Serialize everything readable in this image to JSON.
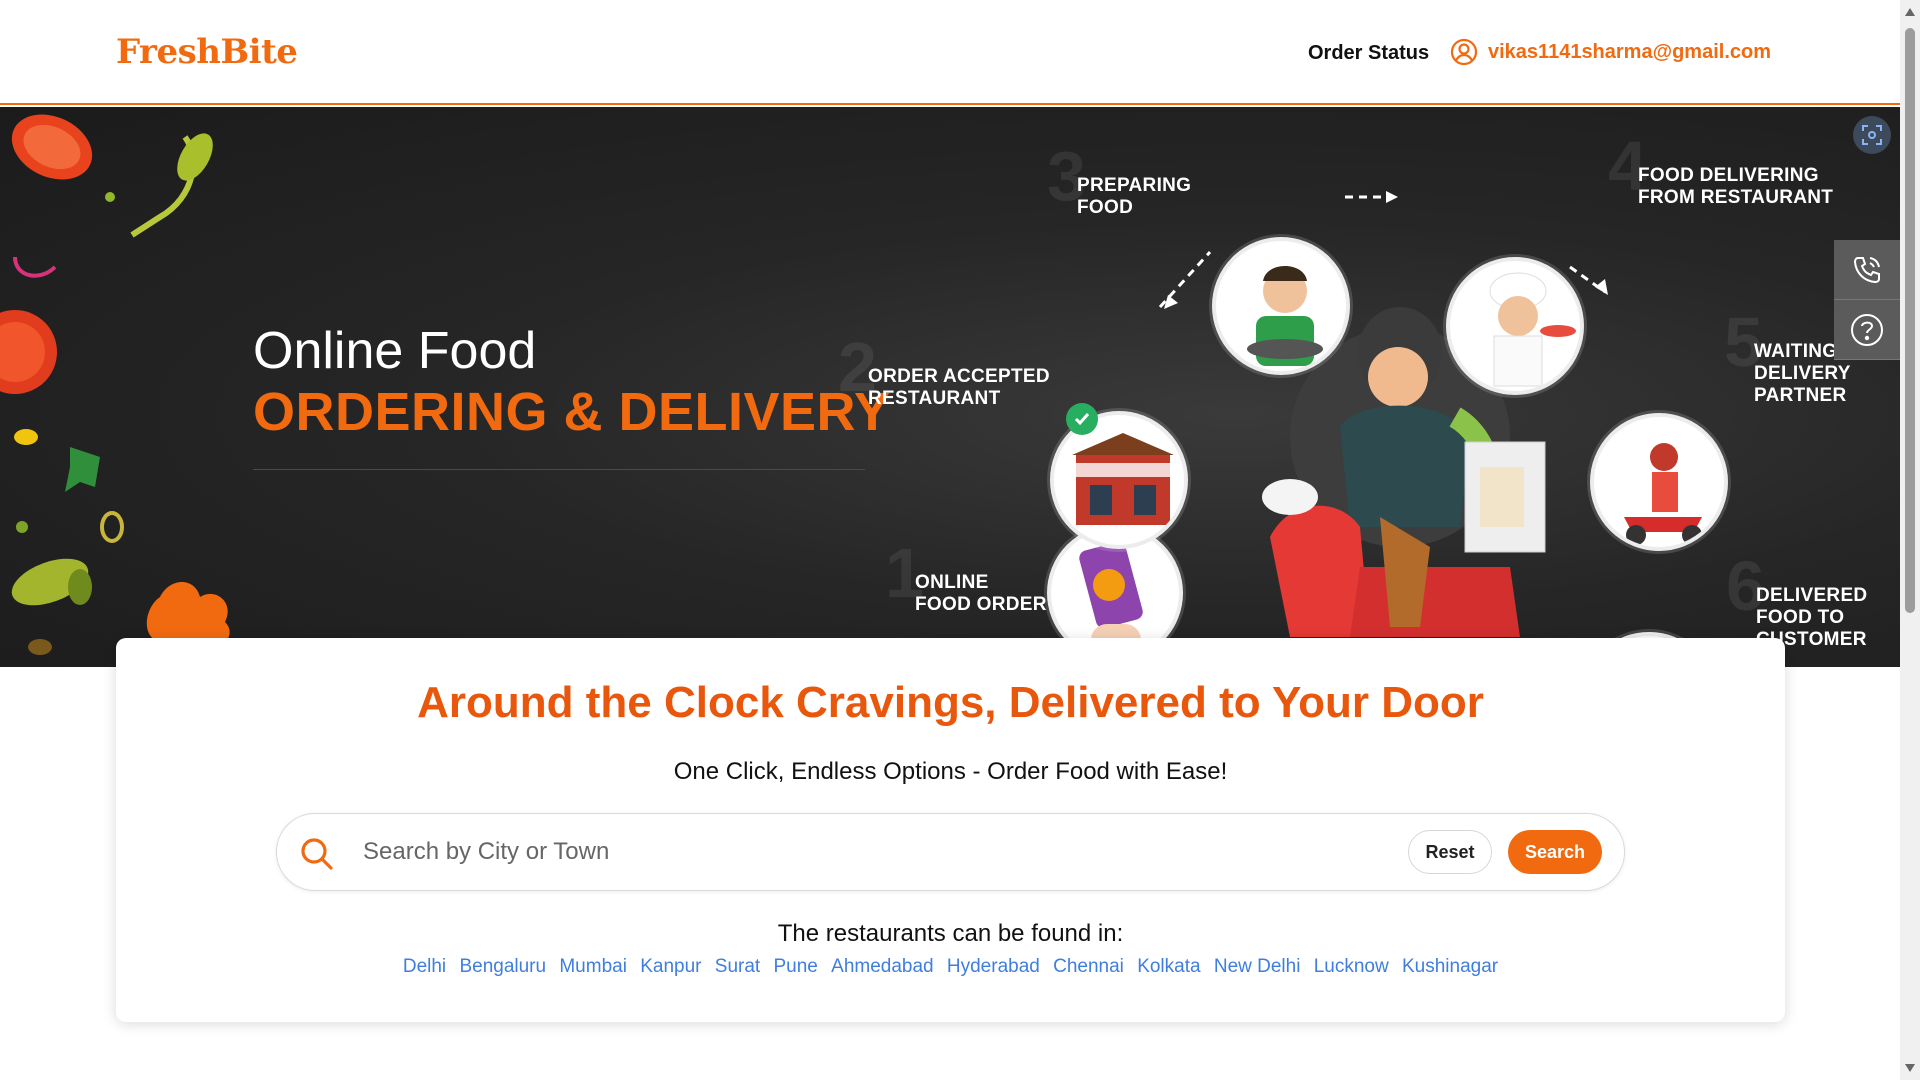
{
  "header": {
    "logo": "FreshBite",
    "order_status": "Order Status",
    "user_email": "vikas1141sharma@gmail.com"
  },
  "hero": {
    "title": "Online Food",
    "subtitle": "ORDERING & DELIVERY",
    "steps": [
      {
        "num": "1",
        "label_line1": "ONLINE",
        "label_line2": "FOOD ORDER"
      },
      {
        "num": "2",
        "label_line1": "ORDER ACCEPTED",
        "label_line2": "RESTAURANT"
      },
      {
        "num": "3",
        "label_line1": "PREPARING",
        "label_line2": "FOOD"
      },
      {
        "num": "4",
        "label_line1": "FOOD DELIVERING",
        "label_line2": "FROM RESTAURANT"
      },
      {
        "num": "5",
        "label_line1": "WAITING",
        "label_line2": "DELIVERY",
        "label_line3": "PARTNER"
      },
      {
        "num": "6",
        "label_line1": "DELIVERED",
        "label_line2": "FOOD TO",
        "label_line3": "CUSTOMER"
      }
    ]
  },
  "card": {
    "title": "Around the Clock Cravings, Delivered to Your Door",
    "subtitle": "One Click, Endless Options - Order Food with Ease!",
    "search": {
      "placeholder": "Search by City or Town",
      "value": "",
      "reset_label": "Reset",
      "search_label": "Search"
    },
    "found_label": "The restaurants can be found in:",
    "cities": [
      "Delhi",
      "Bengaluru",
      "Mumbai",
      "Kanpur",
      "Surat",
      "Pune",
      "Ahmedabad",
      "Hyderabad",
      "Chennai",
      "Kolkata",
      "New Delhi",
      "Lucknow",
      "Kushinagar"
    ]
  },
  "colors": {
    "accent": "#f26a10",
    "title_orange": "#e8570c",
    "link_blue": "#3f7ee0",
    "hero_bg": "#262626"
  },
  "icons": {
    "user": "user-circle-icon",
    "search": "search-icon",
    "phone": "phone-icon",
    "help": "help-circle-icon",
    "scan": "scan-icon"
  }
}
